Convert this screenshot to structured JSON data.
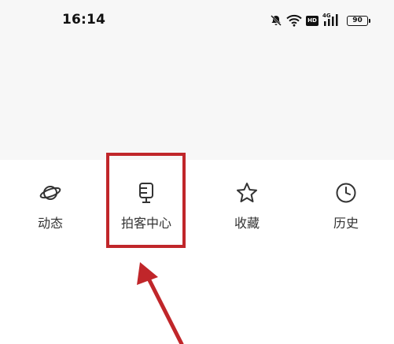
{
  "status_bar": {
    "time": "16:14",
    "network_label": "4G",
    "battery_level": "90",
    "icons": [
      "mute-bell-icon",
      "wifi-icon",
      "hd-icon",
      "signal-icon",
      "battery-icon"
    ]
  },
  "menu": {
    "items": [
      {
        "label": "动态",
        "icon": "planet-icon"
      },
      {
        "label": "拍客中心",
        "icon": "camera-stand-icon",
        "highlighted": true
      },
      {
        "label": "收藏",
        "icon": "star-icon"
      },
      {
        "label": "历史",
        "icon": "clock-icon"
      }
    ]
  },
  "annotation": {
    "highlight_color": "#c0262a"
  }
}
